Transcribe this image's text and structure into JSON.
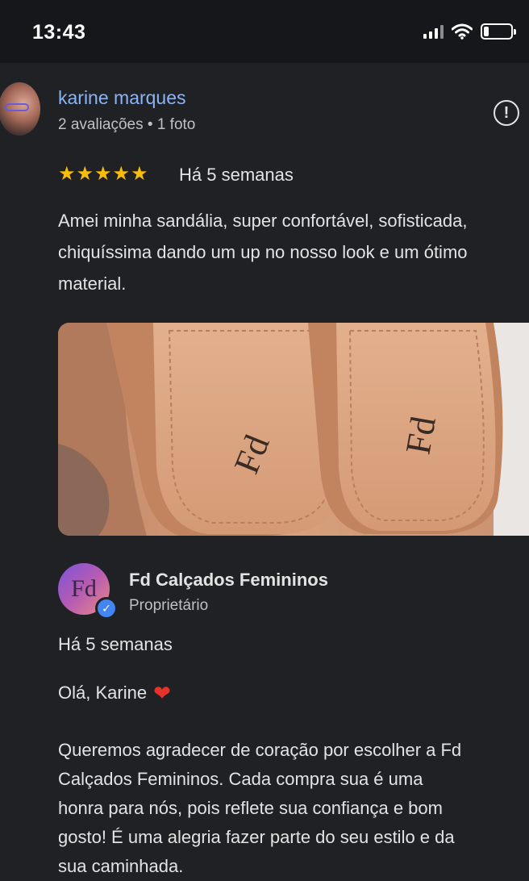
{
  "status_bar": {
    "time": "13:43"
  },
  "review": {
    "reviewer_name": "karine marques",
    "reviewer_meta": "2 avaliações • 1 foto",
    "rating": 5,
    "date": "Há 5 semanas",
    "text": "Amei minha sandália, super confortável, sofisticada, chiquíssima dando um up no nosso look e um ótimo material."
  },
  "owner_response": {
    "name": "Fd Calçados Femininos",
    "role": "Proprietário",
    "date": "Há 5 semanas",
    "greeting": "Olá, Karine",
    "text": "Queremos agradecer de coração por escolher a Fd\nCalçados Femininos. Cada compra sua é uma\nhonra para nós, pois reflete sua confiança e bom\ngosto! É uma alegria fazer parte do seu estilo e da\nsua caminhada."
  },
  "icons": {
    "report": "report-icon",
    "verified": "verified-check-icon",
    "heart": "heart-icon"
  },
  "colors": {
    "background": "#202124",
    "link": "#8ab4f8",
    "star": "#fbbc04",
    "heart": "#e5332a",
    "verified": "#4285f4"
  }
}
